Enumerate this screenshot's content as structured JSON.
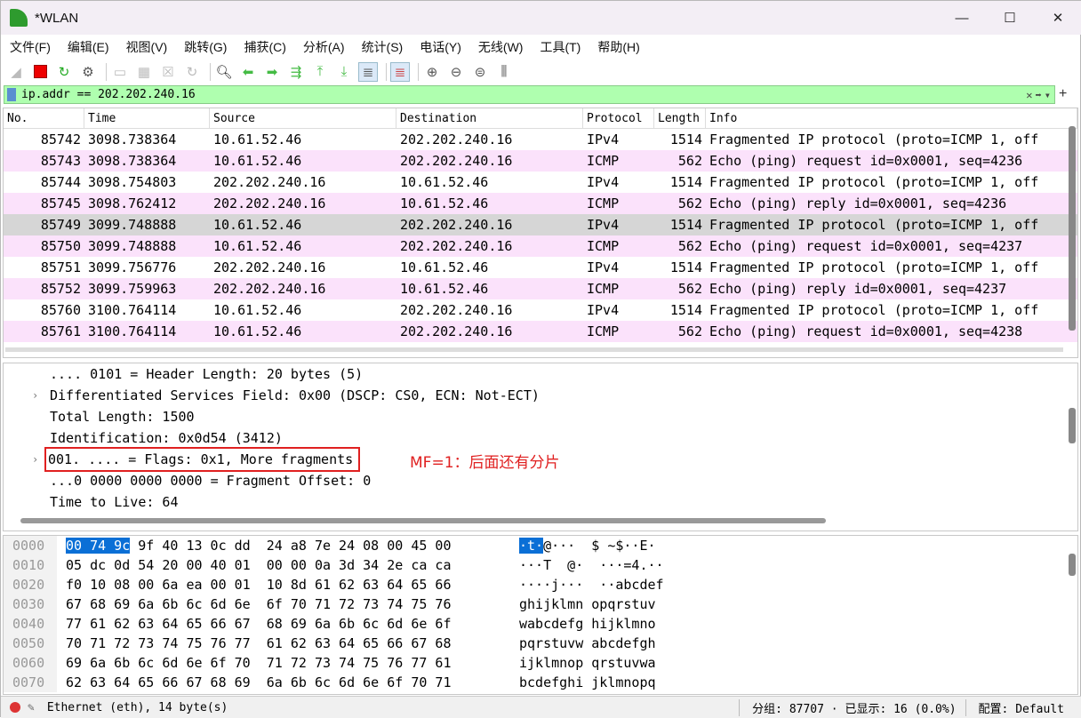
{
  "window": {
    "title": "*WLAN",
    "minimize": "—",
    "maximize": "☐",
    "close": "✕"
  },
  "menu": [
    "文件(F)",
    "编辑(E)",
    "视图(V)",
    "跳转(G)",
    "捕获(C)",
    "分析(A)",
    "统计(S)",
    "电话(Y)",
    "无线(W)",
    "工具(T)",
    "帮助(H)"
  ],
  "filter": {
    "value": "ip.addr == 202.202.240.16",
    "clear": "✕",
    "apply": "➡",
    "dropdown": "▾",
    "add": "+"
  },
  "columns": [
    "No.",
    "Time",
    "Source",
    "Destination",
    "Protocol",
    "Length",
    "Info"
  ],
  "packets": [
    {
      "no": "85742",
      "time": "3098.738364",
      "src": "10.61.52.46",
      "dst": "202.202.240.16",
      "proto": "IPv4",
      "len": "1514",
      "info": "Fragmented IP protocol (proto=ICMP 1, off",
      "style": "white"
    },
    {
      "no": "85743",
      "time": "3098.738364",
      "src": "10.61.52.46",
      "dst": "202.202.240.16",
      "proto": "ICMP",
      "len": "562",
      "info": "Echo (ping) request  id=0x0001, seq=4236",
      "style": "pink"
    },
    {
      "no": "85744",
      "time": "3098.754803",
      "src": "202.202.240.16",
      "dst": "10.61.52.46",
      "proto": "IPv4",
      "len": "1514",
      "info": "Fragmented IP protocol (proto=ICMP 1, off",
      "style": "white"
    },
    {
      "no": "85745",
      "time": "3098.762412",
      "src": "202.202.240.16",
      "dst": "10.61.52.46",
      "proto": "ICMP",
      "len": "562",
      "info": "Echo (ping) reply    id=0x0001, seq=4236",
      "style": "pink"
    },
    {
      "no": "85749",
      "time": "3099.748888",
      "src": "10.61.52.46",
      "dst": "202.202.240.16",
      "proto": "IPv4",
      "len": "1514",
      "info": "Fragmented IP protocol (proto=ICMP 1, off",
      "style": "sel"
    },
    {
      "no": "85750",
      "time": "3099.748888",
      "src": "10.61.52.46",
      "dst": "202.202.240.16",
      "proto": "ICMP",
      "len": "562",
      "info": "Echo (ping) request  id=0x0001, seq=4237",
      "style": "pink"
    },
    {
      "no": "85751",
      "time": "3099.756776",
      "src": "202.202.240.16",
      "dst": "10.61.52.46",
      "proto": "IPv4",
      "len": "1514",
      "info": "Fragmented IP protocol (proto=ICMP 1, off",
      "style": "white"
    },
    {
      "no": "85752",
      "time": "3099.759963",
      "src": "202.202.240.16",
      "dst": "10.61.52.46",
      "proto": "ICMP",
      "len": "562",
      "info": "Echo (ping) reply    id=0x0001, seq=4237",
      "style": "pink"
    },
    {
      "no": "85760",
      "time": "3100.764114",
      "src": "10.61.52.46",
      "dst": "202.202.240.16",
      "proto": "IPv4",
      "len": "1514",
      "info": "Fragmented IP protocol (proto=ICMP 1, off",
      "style": "white"
    },
    {
      "no": "85761",
      "time": "3100.764114",
      "src": "10.61.52.46",
      "dst": "202.202.240.16",
      "proto": "ICMP",
      "len": "562",
      "info": "Echo (ping) request  id=0x0001, seq=4238",
      "style": "pink"
    }
  ],
  "details": [
    {
      "text": ".... 0101 = Header Length: 20 bytes (5)",
      "expand": false
    },
    {
      "text": "Differentiated Services Field: 0x00 (DSCP: CS0, ECN: Not-ECT)",
      "expand": true
    },
    {
      "text": "Total Length: 1500",
      "expand": false
    },
    {
      "text": "Identification: 0x0d54 (3412)",
      "expand": false
    },
    {
      "text": "001. .... = Flags: 0x1, More fragments",
      "expand": true,
      "boxed": true
    },
    {
      "text": "...0 0000 0000 0000 = Fragment Offset: 0",
      "expand": false
    },
    {
      "text": "Time to Live: 64",
      "expand": false
    }
  ],
  "annotation": "MF=1：后面还有分片",
  "bytes": [
    {
      "off": "0000",
      "hex_hl": "00 74 9c",
      "hex": " 9f 40 13 0c dd  24 a8 7e 24 08 00 45 00",
      "asc_hl": "·t·",
      "asc": "@···  $ ~$··E·"
    },
    {
      "off": "0010",
      "hex": "05 dc 0d 54 20 00 40 01  00 00 0a 3d 34 2e ca ca",
      "asc": "···T  @·  ···=4.··"
    },
    {
      "off": "0020",
      "hex": "f0 10 08 00 6a ea 00 01  10 8d 61 62 63 64 65 66",
      "asc": "····j···  ··abcdef"
    },
    {
      "off": "0030",
      "hex": "67 68 69 6a 6b 6c 6d 6e  6f 70 71 72 73 74 75 76",
      "asc": "ghijklmn opqrstuv"
    },
    {
      "off": "0040",
      "hex": "77 61 62 63 64 65 66 67  68 69 6a 6b 6c 6d 6e 6f",
      "asc": "wabcdefg hijklmno"
    },
    {
      "off": "0050",
      "hex": "70 71 72 73 74 75 76 77  61 62 63 64 65 66 67 68",
      "asc": "pqrstuvw abcdefgh"
    },
    {
      "off": "0060",
      "hex": "69 6a 6b 6c 6d 6e 6f 70  71 72 73 74 75 76 77 61",
      "asc": "ijklmnop qrstuvwa"
    },
    {
      "off": "0070",
      "hex": "62 63 64 65 66 67 68 69  6a 6b 6c 6d 6e 6f 70 71",
      "asc": "bcdefghi jklmnopq"
    }
  ],
  "status": {
    "field": "Ethernet (eth), 14 byte(s)",
    "packets": "分组: 87707 · 已显示: 16 (0.0%)",
    "profile": "配置: Default"
  }
}
